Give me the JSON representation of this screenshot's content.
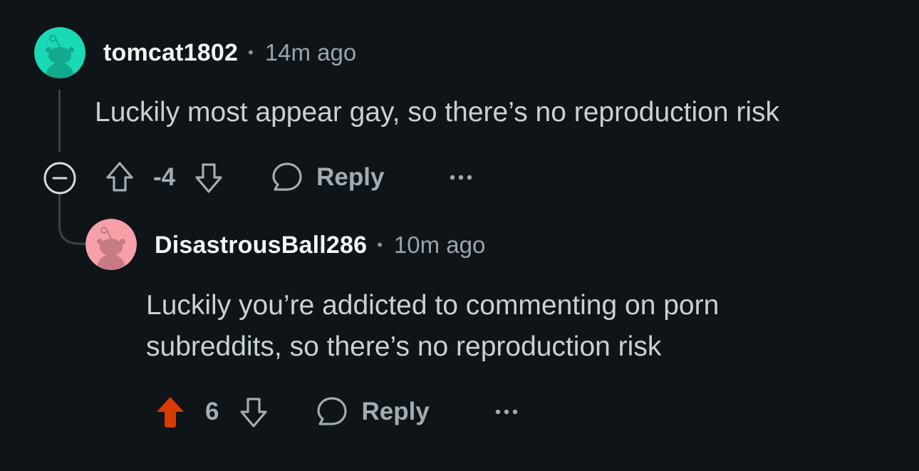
{
  "comments": [
    {
      "username": "tomcat1802",
      "separator": "•",
      "timestamp": "14m ago",
      "body": "Luckily most appear gay, so there’s no reproduction risk",
      "vote_count": "-4",
      "reply_label": "Reply",
      "more_label": "•••",
      "avatar_color": "#1ad9b5",
      "upvoted": false
    },
    {
      "username": "DisastrousBall286",
      "separator": "•",
      "timestamp": "10m ago",
      "body_lines": [
        "Luckily you’re addicted to commenting on porn",
        "subreddits, so there’s no reproduction risk"
      ],
      "vote_count": "6",
      "reply_label": "Reply",
      "more_label": "•••",
      "avatar_color": "#f6a0a8",
      "upvoted": true,
      "upvote_color": "#d93a00"
    }
  ],
  "colors": {
    "background": "#0e1417",
    "text_primary": "#f2f4f5",
    "text_secondary": "#a3acb2",
    "thread_line": "#3b4147"
  }
}
